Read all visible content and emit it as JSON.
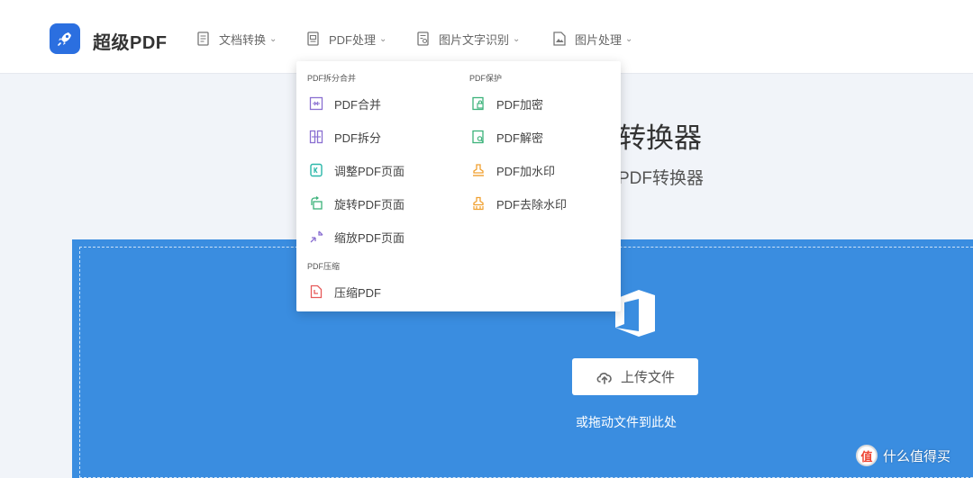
{
  "header": {
    "brand": "超级PDF",
    "nav": [
      {
        "label": "文档转换",
        "icon": "document-icon"
      },
      {
        "label": "PDF处理",
        "icon": "pdf-file-icon"
      },
      {
        "label": "图片文字识别",
        "icon": "ocr-document-icon"
      },
      {
        "label": "图片处理",
        "icon": "image-file-icon"
      }
    ]
  },
  "hero": {
    "title": "转换器",
    "subtitle": "PDF转换器"
  },
  "dropdown": {
    "groups": [
      {
        "title": "PDF拆分合并",
        "items": [
          "PDF合并",
          "PDF拆分",
          "调整PDF页面",
          "旋转PDF页面",
          "缩放PDF页面"
        ]
      },
      {
        "title": "PDF压缩",
        "items": [
          "压缩PDF"
        ]
      },
      {
        "title": "PDF保护",
        "items": [
          "PDF加密",
          "PDF解密",
          "PDF加水印",
          "PDF去除水印"
        ]
      }
    ]
  },
  "upload": {
    "button": "上传文件",
    "hint": "或拖动文件到此处"
  },
  "watermark": {
    "logo_char": "值",
    "text": "什么值得买"
  },
  "colors": {
    "accent": "#3a8de0",
    "brand_blue": "#2b6fe0",
    "icon_purple": "#8a6fd1",
    "icon_teal": "#2ab7a9",
    "icon_green": "#3bb27a",
    "icon_orange": "#f0a030",
    "icon_red": "#e65a5a"
  }
}
